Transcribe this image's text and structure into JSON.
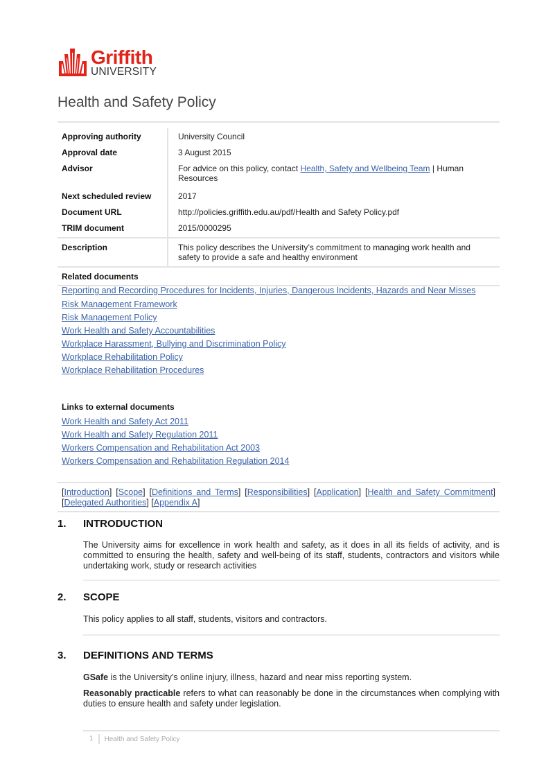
{
  "logo": {
    "name": "Griffith",
    "subname": "UNIVERSITY",
    "brand_color": "#e2231a"
  },
  "document": {
    "title": "Health and Safety Policy"
  },
  "metadata": [
    {
      "label": "Approving authority",
      "value": "University Council"
    },
    {
      "label": "Approval date",
      "value": "3 August 2015"
    },
    {
      "label": "Advisor",
      "value_prefix": "For advice on this policy, contact ",
      "value_link": "Health, Safety and Wellbeing Team",
      "value_suffix": " | Human Resources"
    },
    {
      "label": "Next scheduled review",
      "value": "2017"
    },
    {
      "label": "Document URL",
      "value": "http://policies.griffith.edu.au/pdf/Health and Safety Policy.pdf"
    },
    {
      "label": "TRIM document",
      "value": "2015/0000295"
    },
    {
      "label": "Description",
      "value": "This policy describes the University’s commitment to managing work health and safety to provide a safe and healthy environment"
    }
  ],
  "related_documents": {
    "heading": "Related documents",
    "links": [
      "Reporting and Recording Procedures for Incidents, Injuries, Dangerous Incidents, Hazards and Near Misses",
      "Risk Management Framework",
      "Risk Management Policy",
      "Work Health and Safety Accountabilities",
      "Workplace Harassment, Bullying and Discrimination Policy",
      "Workplace Rehabilitation Policy",
      "Workplace Rehabilitation Procedures"
    ]
  },
  "external_documents": {
    "heading": "Links to external documents",
    "links": [
      "Work Health and Safety Act 2011",
      "Work Health and Safety Regulation 2011",
      "Workers Compensation and Rehabilitation Act 2003",
      "Workers Compensation and Rehabilitation Regulation 2014"
    ]
  },
  "toc": [
    "Introduction",
    "Scope",
    "Definitions and Terms",
    "Responsibilities",
    "Application",
    "Health and Safety Commitment",
    "Delegated Authorities",
    "Appendix A"
  ],
  "sections": [
    {
      "number": "1.",
      "title": "INTRODUCTION",
      "body": "The University aims for excellence in work health and safety, as it does in all its fields of activity, and is committed to ensuring the health, safety and well-being of its staff, students, contractors and visitors while undertaking work, study or research activities"
    },
    {
      "number": "2.",
      "title": "SCOPE",
      "body": "This policy applies to all staff, students, visitors and contractors."
    },
    {
      "number": "3.",
      "title": "DEFINITIONS AND TERMS",
      "definitions": [
        {
          "term": "GSafe",
          "definition": " is the University’s online injury, illness, hazard and near miss reporting system."
        },
        {
          "term": "Reasonably practicable",
          "definition": " refers to what can reasonably be done in the circumstances when complying with duties to ensure health and safety under legislation."
        }
      ]
    }
  ],
  "footer": {
    "page_number": "1",
    "title": "Health and Safety Policy"
  }
}
